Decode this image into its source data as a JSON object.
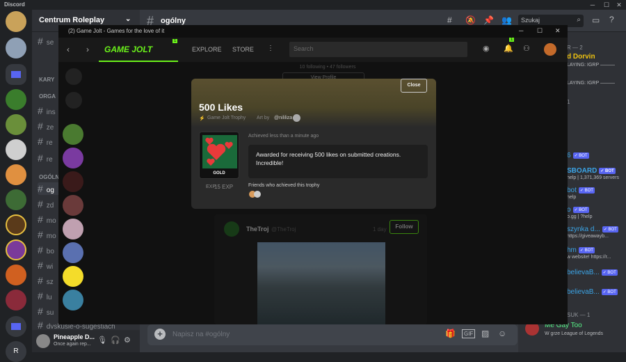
{
  "app": {
    "name": "Discord"
  },
  "server": {
    "name": "Centrum Roleplay"
  },
  "channel": {
    "name": "ogólny",
    "search_placeholder": "Szukaj"
  },
  "categories": {
    "c1": "KARY",
    "c2": "ORGA",
    "c3": "ORGA",
    "c4": "OGÓLN"
  },
  "channels": {
    "se": "se",
    "ins": "ins",
    "ze": "ze",
    "re": "re",
    "re2": "re",
    "og": "og",
    "zd": "zd",
    "mo": "mo",
    "mo2": "mo",
    "bo": "bo",
    "wi": "wi",
    "sz": "sz",
    "lu": "lu",
    "su": "su",
    "dv": "dvskusie-o-sugestiach"
  },
  "user": {
    "name": "Pineapple D...",
    "status": "Once again rep..."
  },
  "compose": {
    "placeholder": "Napisz na #ogólny"
  },
  "gamejolt": {
    "window_title": "(2) Game Jolt - Games for the love of it",
    "logo": "GAME JOLT",
    "nav_explore": "EXPLORE",
    "nav_store": "STORE",
    "search_placeholder": "Search",
    "badge": "1",
    "profile_stats": "10 following • 47 followers",
    "view_profile": "View Profile",
    "post_author": "TheTroj",
    "post_handle": "@TheTroj",
    "post_time": "1 day",
    "follow_label": "Follow",
    "modal": {
      "close": "Close",
      "title": "500 Likes",
      "subtitle": "Game Jolt Trophy",
      "art_by": "Art by",
      "artist": "@nililiza",
      "achieved": "Achieved less than a minute ago",
      "description": "Awarded for receiving 500 likes on submitted creations. Incredible!",
      "tier": "GOLD",
      "exp": "15 EXP",
      "friends": "Friends who achieved this trophy"
    }
  },
  "members": {
    "header1": "R — 2",
    "m1": "d Dorvin",
    "m1s": "LAYING: IGRP ———",
    "m2s": "LAYING: IGRP ———",
    "header2": "1",
    "b1": "6",
    "b2": "SBOARD",
    "b2s": "help | 1,371,369 servers",
    "b3": "bot",
    "b3s": "help",
    "b4": "o",
    "b4s": "o.gg | ?help",
    "b5": "szynka d...",
    "b5s": "https://giveawayb...",
    "b6": "hm",
    "b6s": "w website! https://r...",
    "b7": "believaB...",
    "b8": "believaB...",
    "bot_tag": "✓ BOT",
    "header3": "SUK — 1",
    "m9": "Me Gay Too",
    "m9s": "W grze League of Legends"
  },
  "colors": {
    "accent": "#5865f2",
    "gj_green": "#6bf21a",
    "gold": "#f6d36c"
  }
}
